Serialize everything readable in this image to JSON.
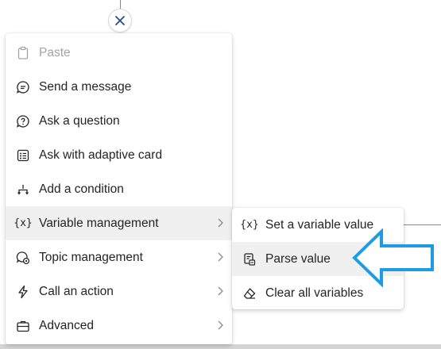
{
  "menu": {
    "items": [
      {
        "label": "Paste",
        "icon": "clipboard-icon",
        "disabled": true
      },
      {
        "label": "Send a message",
        "icon": "chat-bubble-icon"
      },
      {
        "label": "Ask a question",
        "icon": "question-bubble-icon"
      },
      {
        "label": "Ask with adaptive card",
        "icon": "adaptive-card-icon"
      },
      {
        "label": "Add a condition",
        "icon": "branch-icon"
      },
      {
        "label": "Variable management",
        "icon": "variable-icon",
        "submenu": true,
        "active": true
      },
      {
        "label": "Topic management",
        "icon": "topic-gear-icon",
        "submenu": true
      },
      {
        "label": "Call an action",
        "icon": "lightning-icon",
        "submenu": true
      },
      {
        "label": "Advanced",
        "icon": "briefcase-icon",
        "submenu": true
      }
    ]
  },
  "submenu": {
    "items": [
      {
        "label": "Set a variable value",
        "icon": "variable-icon"
      },
      {
        "label": "Parse value",
        "icon": "parse-value-icon",
        "hover": true
      },
      {
        "label": "Clear all variables",
        "icon": "eraser-icon"
      }
    ]
  },
  "glyphs": {
    "variable": "{x}"
  },
  "colors": {
    "accent_arrow": "#1e9be6",
    "menu_active_bg": "#f0f0f0",
    "disabled_text": "#a3a3a3"
  }
}
